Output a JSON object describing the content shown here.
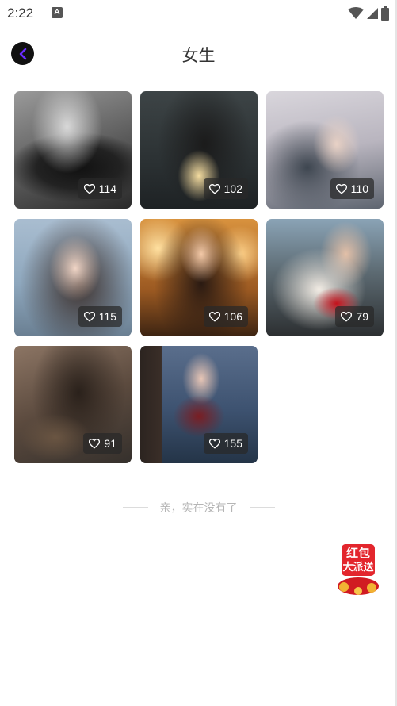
{
  "status_bar": {
    "time": "2:22",
    "app_icon": "A"
  },
  "header": {
    "title": "女生"
  },
  "photos": [
    {
      "likes": "114",
      "icon": "heart-icon"
    },
    {
      "likes": "102",
      "icon": "heart-icon"
    },
    {
      "likes": "110",
      "icon": "heart-icon"
    },
    {
      "likes": "115",
      "icon": "heart-icon"
    },
    {
      "likes": "106",
      "icon": "heart-icon"
    },
    {
      "likes": "79",
      "icon": "heart-icon"
    },
    {
      "likes": "91",
      "icon": "heart-icon"
    },
    {
      "likes": "155",
      "icon": "heart-icon"
    }
  ],
  "footer": {
    "end_text": "亲，实在没有了"
  },
  "red_packet": {
    "line1": "红包",
    "line2": "大派送"
  },
  "colors": {
    "back_button_bg": "#111111",
    "back_arrow": "#6a2cff",
    "badge_bg": "#282828",
    "red_packet": "#e3262d"
  }
}
